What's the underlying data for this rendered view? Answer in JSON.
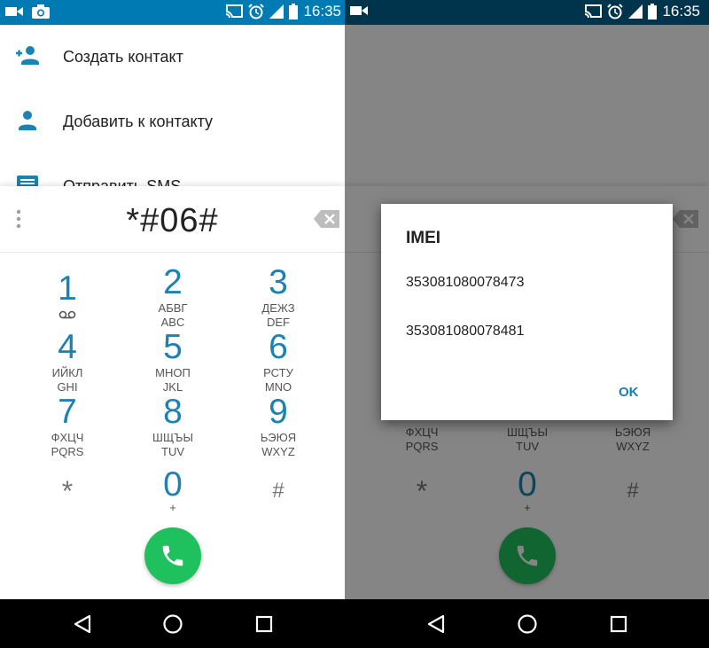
{
  "status_bar": {
    "time": "16:35",
    "bg_color": "#007ab3"
  },
  "menu": {
    "items": [
      {
        "label": "Создать контакт",
        "icon": "add-contact-icon"
      },
      {
        "label": "Добавить к контакту",
        "icon": "person-icon"
      },
      {
        "label": "Отправить SMS",
        "icon": "sms-icon"
      }
    ]
  },
  "dialer": {
    "digits": "*#06#",
    "keys": [
      {
        "num": "1",
        "l1": "",
        "l2": ""
      },
      {
        "num": "2",
        "l1": "АБВГ",
        "l2": "ABC"
      },
      {
        "num": "3",
        "l1": "ДЕЖЗ",
        "l2": "DEF"
      },
      {
        "num": "4",
        "l1": "ИЙКЛ",
        "l2": "GHI"
      },
      {
        "num": "5",
        "l1": "МНОП",
        "l2": "JKL"
      },
      {
        "num": "6",
        "l1": "РСТУ",
        "l2": "MNO"
      },
      {
        "num": "7",
        "l1": "ФХЦЧ",
        "l2": "PQRS"
      },
      {
        "num": "8",
        "l1": "ШЩЪЫ",
        "l2": "TUV"
      },
      {
        "num": "9",
        "l1": "ЬЭЮЯ",
        "l2": "WXYZ"
      }
    ],
    "star": "*",
    "zero": "0",
    "zero_sub": "+",
    "hash": "#",
    "call_color": "#1fc15e",
    "accent_color": "#1c82b4"
  },
  "dialog": {
    "title": "IMEI",
    "values": [
      "353081080078473",
      "353081080078481"
    ],
    "ok_label": "OK"
  }
}
